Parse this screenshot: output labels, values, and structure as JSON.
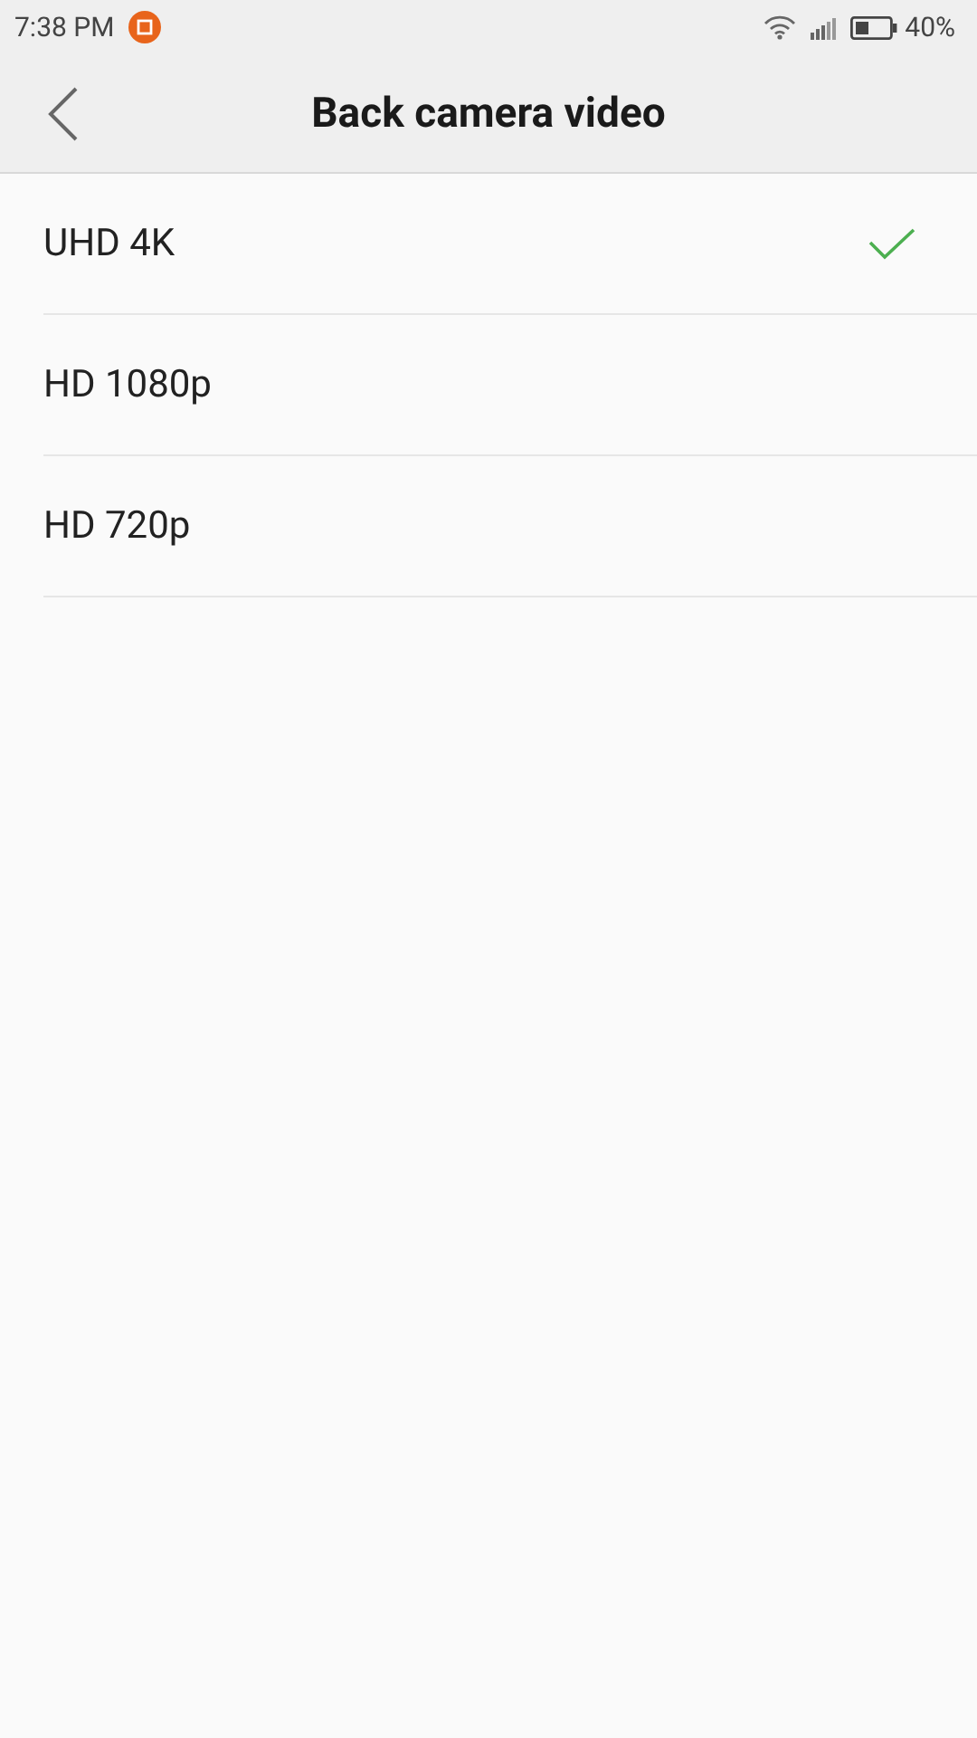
{
  "status_bar": {
    "time": "7:38 PM",
    "battery_text": "40%"
  },
  "header": {
    "title": "Back camera video"
  },
  "options": [
    {
      "label": "UHD 4K",
      "selected": true
    },
    {
      "label": "HD 1080p",
      "selected": false
    },
    {
      "label": "HD 720p",
      "selected": false
    }
  ]
}
